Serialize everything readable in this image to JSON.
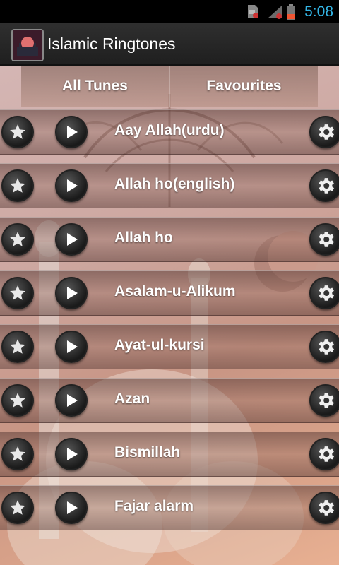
{
  "status_bar": {
    "time": "5:08",
    "icons": [
      "sd-card-icon",
      "signal-icon",
      "battery-icon"
    ]
  },
  "action_bar": {
    "title": "Islamic Ringtones",
    "icon": "app-icon"
  },
  "tabs": [
    {
      "label": "All Tunes"
    },
    {
      "label": "Favourites"
    }
  ],
  "ringtones": [
    {
      "name": "Aay Allah(urdu)"
    },
    {
      "name": "Allah ho(english)"
    },
    {
      "name": "Allah ho"
    },
    {
      "name": "Asalam-u-Alikum"
    },
    {
      "name": "Ayat-ul-kursi"
    },
    {
      "name": "Azan"
    },
    {
      "name": "Bismillah"
    },
    {
      "name": "Fajar alarm"
    }
  ],
  "row_icons": {
    "favourite": "star-icon",
    "play": "play-icon",
    "settings": "gear-icon"
  },
  "colors": {
    "status_accent": "#33b5e5",
    "action_bar": "#2a2a2a"
  }
}
